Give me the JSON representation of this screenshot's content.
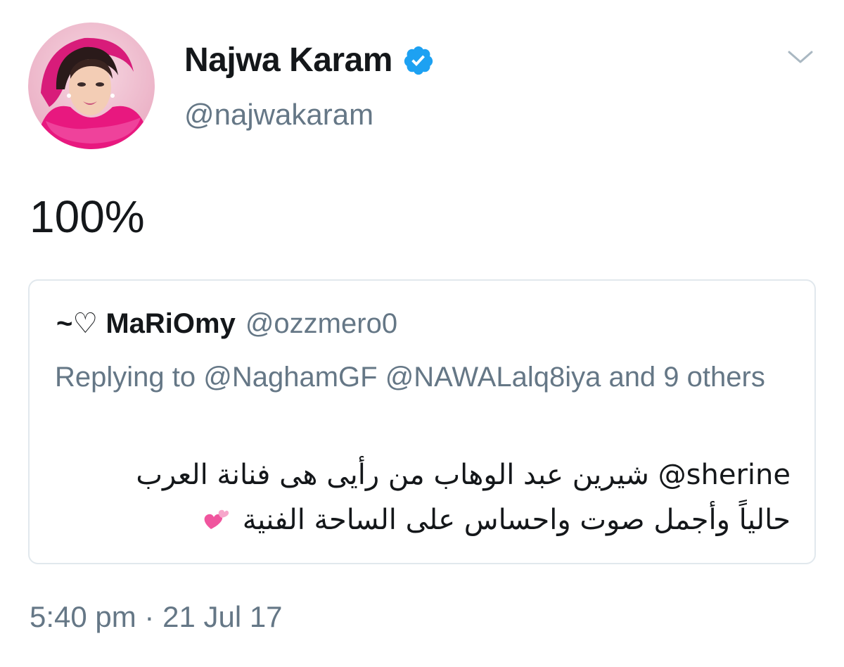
{
  "author": {
    "display_name": "Najwa Karam",
    "handle": "@najwakaram",
    "verified": true,
    "avatar_icon": "profile-photo"
  },
  "tweet": {
    "text": "100%",
    "timestamp": "5:40 pm · 21 Jul 17"
  },
  "quoted_tweet": {
    "display_name": "~♡ MaRiOmy",
    "handle": "@ozzmero0",
    "reply_context": "Replying to @NaghamGF @NAWALalq8iya and 9 others",
    "mention": "@sherine",
    "line1": "شيرين عبد الوهاب من رأيى هى فنانة العرب",
    "line2": "حالياً وأجمل صوت واحساس على الساحة الفنية",
    "emoji_icon": "two-hearts-icon"
  },
  "colors": {
    "verified_blue": "#1da1f2",
    "secondary_text": "#657786",
    "border": "#e1e8ed",
    "heart_pink": "#f0559e"
  }
}
